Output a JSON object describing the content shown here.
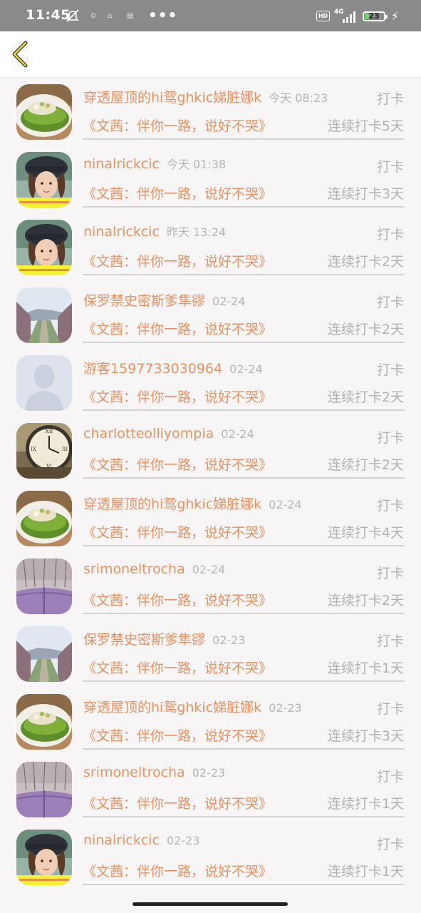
{
  "status_bar": {
    "time": "11:45",
    "mini_icons": [
      "©",
      "⌂",
      "▤"
    ],
    "more": "•••",
    "hd": "HD",
    "network": "4G",
    "battery": "23",
    "battery_level": 0.23
  },
  "navbar": {
    "back_icon": "chevron-left-icon"
  },
  "colors": {
    "accent": "#e99262",
    "muted": "#b2b2b2"
  },
  "records": [
    {
      "user": "穿透屋顶的hi鸳ghkic娣脏娜k",
      "time": "今天 08:23",
      "action": "打卡",
      "book": "《文茜：伴你一路，说好不哭》",
      "streak": "连续打卡5天",
      "avatar": "food"
    },
    {
      "user": "ninalrickcic",
      "time": "今天 01:38",
      "action": "打卡",
      "book": "《文茜：伴你一路，说好不哭》",
      "streak": "连续打卡3天",
      "avatar": "girl"
    },
    {
      "user": "ninalrickcic",
      "time": "昨天 13:24",
      "action": "打卡",
      "book": "《文茜：伴你一路，说好不哭》",
      "streak": "连续打卡2天",
      "avatar": "girl"
    },
    {
      "user": "保罗禁史密斯爹隼豂",
      "time": "02-24",
      "action": "打卡",
      "book": "《文茜：伴你一路，说好不哭》",
      "streak": "连续打卡2天",
      "avatar": "road"
    },
    {
      "user": "游客1597733030964",
      "time": "02-24",
      "action": "打卡",
      "book": "《文茜：伴你一路，说好不哭》",
      "streak": "连续打卡2天",
      "avatar": "default"
    },
    {
      "user": "charlotteolliyompia",
      "time": "02-24",
      "action": "打卡",
      "book": "《文茜：伴你一路，说好不哭》",
      "streak": "连续打卡2天",
      "avatar": "clock"
    },
    {
      "user": "穿透屋顶的hi鸳ghkic娣脏娜k",
      "time": "02-24",
      "action": "打卡",
      "book": "《文茜：伴你一路，说好不哭》",
      "streak": "连续打卡4天",
      "avatar": "food"
    },
    {
      "user": "srimoneltrocha",
      "time": "02-24",
      "action": "打卡",
      "book": "《文茜：伴你一路，说好不哭》",
      "streak": "连续打卡2天",
      "avatar": "umbrella"
    },
    {
      "user": "保罗禁史密斯爹隼豂",
      "time": "02-23",
      "action": "打卡",
      "book": "《文茜：伴你一路，说好不哭》",
      "streak": "连续打卡1天",
      "avatar": "road"
    },
    {
      "user": "穿透屋顶的hi鸳ghkic娣脏娜k",
      "time": "02-23",
      "action": "打卡",
      "book": "《文茜：伴你一路，说好不哭》",
      "streak": "连续打卡3天",
      "avatar": "food"
    },
    {
      "user": "srimoneltrocha",
      "time": "02-23",
      "action": "打卡",
      "book": "《文茜：伴你一路，说好不哭》",
      "streak": "连续打卡1天",
      "avatar": "umbrella"
    },
    {
      "user": "ninalrickcic",
      "time": "02-23",
      "action": "打卡",
      "book": "《文茜：伴你一路，说好不哭》",
      "streak": "连续打卡1天",
      "avatar": "girl"
    }
  ]
}
